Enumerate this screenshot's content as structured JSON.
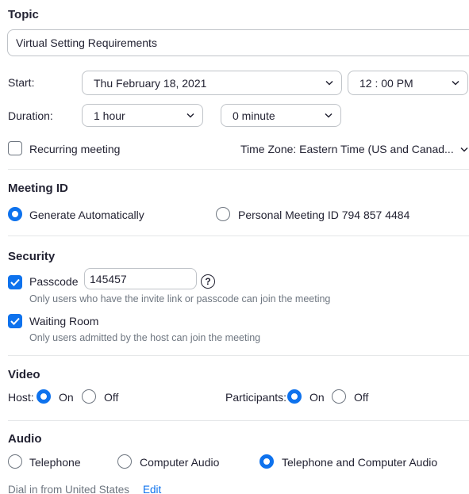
{
  "topic": {
    "heading": "Topic",
    "value": "Virtual Setting Requirements"
  },
  "start": {
    "label": "Start:",
    "date": "Thu  February  18,  2021",
    "time": "12 : 00   PM"
  },
  "duration": {
    "label": "Duration:",
    "hours": "1 hour",
    "minutes": "0 minute"
  },
  "recurring": {
    "label": "Recurring meeting",
    "checked": false
  },
  "timezone": {
    "value": "Time Zone: Eastern Time (US and Canad..."
  },
  "meeting_id": {
    "heading": "Meeting ID",
    "option_auto": "Generate Automatically",
    "option_personal": "Personal Meeting ID 794 857 4484",
    "selected": "auto"
  },
  "security": {
    "heading": "Security",
    "passcode_label": "Passcode",
    "passcode_value": "145457",
    "help_glyph": "?",
    "passcode_note": "Only users who have the invite link or passcode can join the meeting",
    "waiting_room_label": "Waiting Room",
    "waiting_room_note": "Only users admitted by the host can join the meeting"
  },
  "video": {
    "heading": "Video",
    "host_label": "Host:",
    "participants_label": "Participants:",
    "on_label": "On",
    "off_label": "Off"
  },
  "audio": {
    "heading": "Audio",
    "telephone": "Telephone",
    "computer": "Computer Audio",
    "both": "Telephone and Computer Audio",
    "dial_in": "Dial in from United States",
    "edit": "Edit"
  },
  "colors": {
    "accent": "#0e72ed",
    "text": "#232333",
    "muted": "#6e7680",
    "border": "#bfc3c8"
  }
}
